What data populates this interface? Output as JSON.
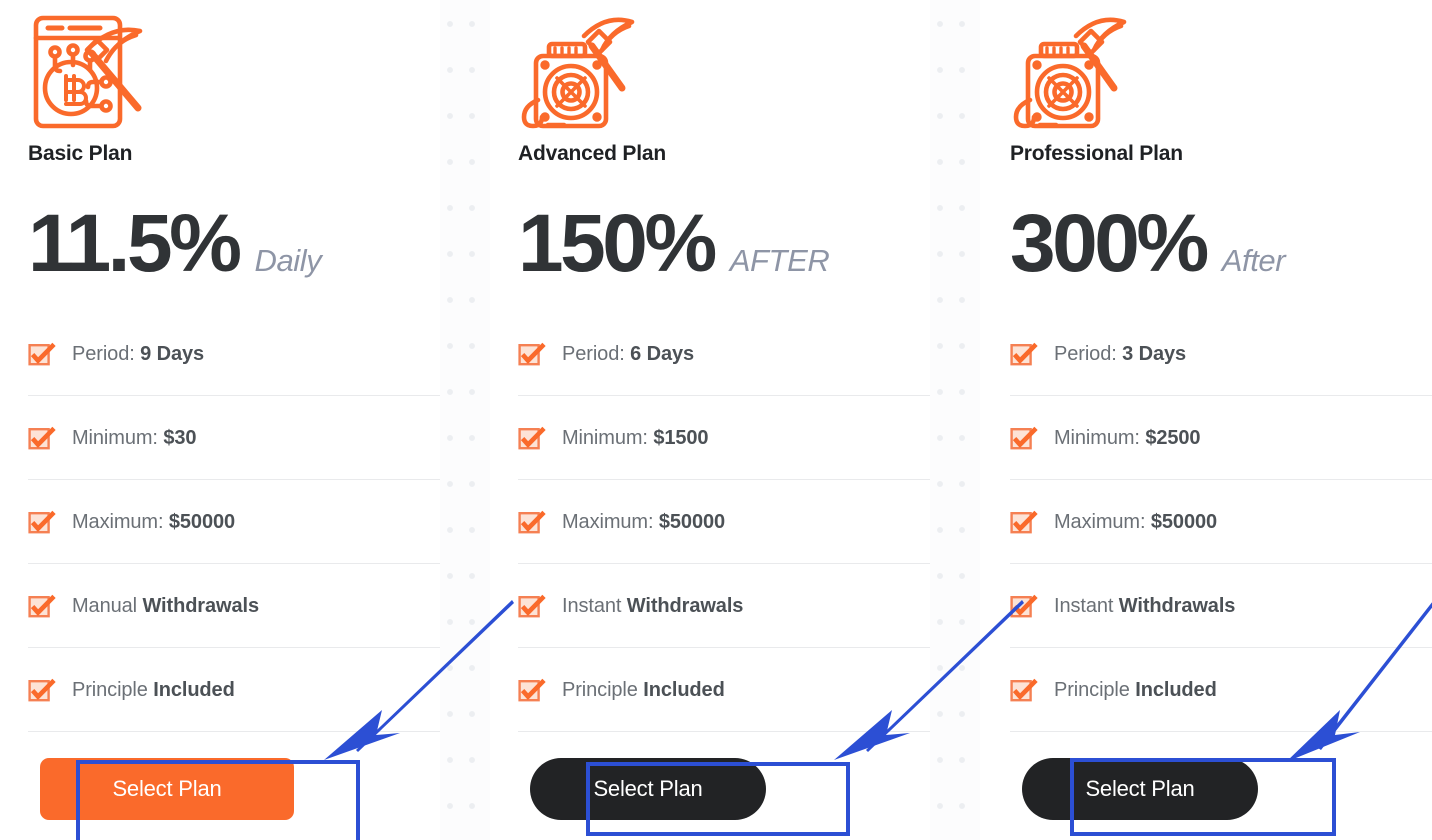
{
  "theme": {
    "accent_orange": "#fa6a2b",
    "dark_button": "#222325",
    "annotation_blue": "#2c4fd4",
    "heading_text": "#1f2124",
    "rate_text": "#303336",
    "suffix_text": "#8e95a6",
    "feature_text": "#6b7076",
    "feature_strong": "#4c5156",
    "divider": "#e9eaec",
    "card_bg": "#ffffff",
    "gutter_bg": "#fcfcfd"
  },
  "plans": [
    {
      "icon_name": "bitcoin-mining-browser-icon",
      "name": "Basic Plan",
      "rate": "11.5%",
      "rate_suffix": "Daily",
      "features": [
        {
          "icon_name": "orange-check-box-icon",
          "label": "Period: ",
          "value": "9 Days"
        },
        {
          "icon_name": "orange-check-box-icon",
          "label": "Minimum: ",
          "value": "$30"
        },
        {
          "icon_name": "orange-check-box-icon",
          "label": "Maximum: ",
          "value": "$50000"
        },
        {
          "icon_name": "orange-check-box-icon",
          "label": "Manual ",
          "value": "Withdrawals"
        },
        {
          "icon_name": "orange-check-box-icon",
          "label": "Principle ",
          "value": "Included"
        }
      ],
      "button_label": "Select Plan",
      "button_style": "orange"
    },
    {
      "icon_name": "mining-rig-pickaxe-icon",
      "name": "Advanced Plan",
      "rate": "150%",
      "rate_suffix": "AFTER",
      "features": [
        {
          "icon_name": "orange-check-box-icon",
          "label": "Period: ",
          "value": "6 Days"
        },
        {
          "icon_name": "orange-check-box-icon",
          "label": "Minimum: ",
          "value": "$1500"
        },
        {
          "icon_name": "orange-check-box-icon",
          "label": "Maximum: ",
          "value": "$50000"
        },
        {
          "icon_name": "orange-check-box-icon",
          "label": "Instant ",
          "value": "Withdrawals"
        },
        {
          "icon_name": "orange-check-box-icon",
          "label": "Principle ",
          "value": "Included"
        }
      ],
      "button_label": "Select Plan",
      "button_style": "dark"
    },
    {
      "icon_name": "mining-rig-pickaxe-icon",
      "name": "Professional Plan",
      "rate": "300%",
      "rate_suffix": "After",
      "features": [
        {
          "icon_name": "orange-check-box-icon",
          "label": "Period: ",
          "value": "3 Days"
        },
        {
          "icon_name": "orange-check-box-icon",
          "label": "Minimum: ",
          "value": "$2500"
        },
        {
          "icon_name": "orange-check-box-icon",
          "label": "Maximum: ",
          "value": "$50000"
        },
        {
          "icon_name": "orange-check-box-icon",
          "label": "Instant ",
          "value": "Withdrawals"
        },
        {
          "icon_name": "orange-check-box-icon",
          "label": "Principle ",
          "value": "Included"
        }
      ],
      "button_label": "Select Plan",
      "button_style": "dark"
    }
  ],
  "annotations": [
    {
      "name": "highlight-box-select-plan-basic",
      "shape": "rectangle"
    },
    {
      "name": "highlight-box-select-plan-advanced",
      "shape": "rectangle"
    },
    {
      "name": "highlight-box-select-plan-professional",
      "shape": "rectangle"
    },
    {
      "name": "pointer-arrow-select-plan-basic",
      "shape": "arrow"
    },
    {
      "name": "pointer-arrow-select-plan-advanced",
      "shape": "arrow"
    },
    {
      "name": "pointer-arrow-select-plan-professional",
      "shape": "arrow"
    }
  ]
}
